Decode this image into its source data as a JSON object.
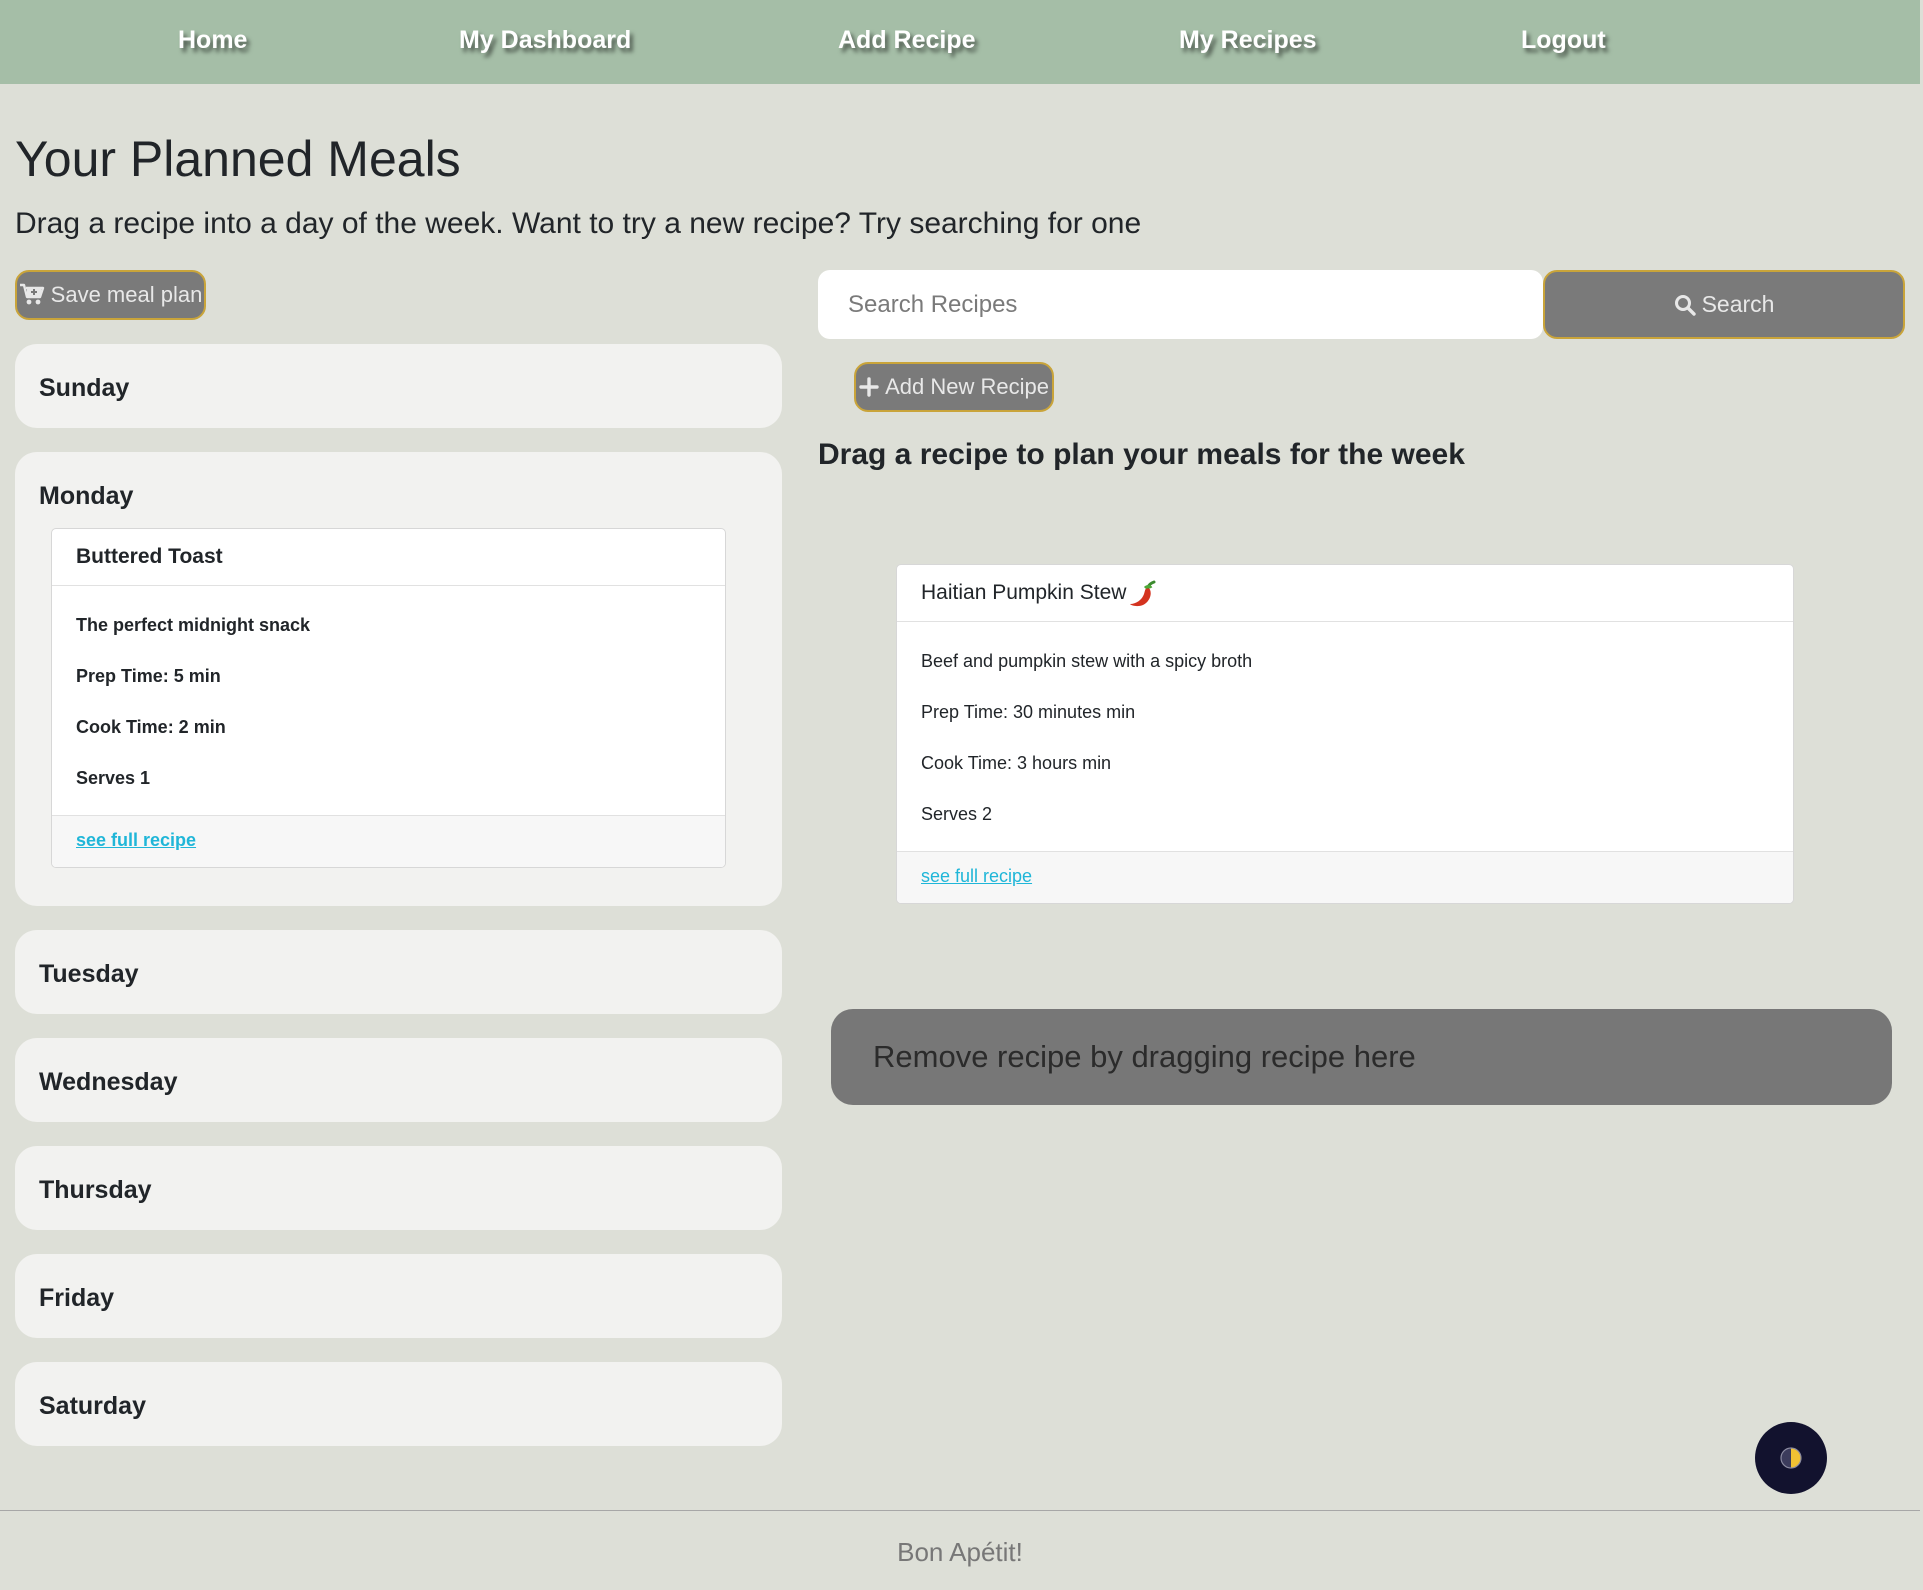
{
  "nav": {
    "items": [
      {
        "label": "Home"
      },
      {
        "label": "My Dashboard"
      },
      {
        "label": "Add Recipe"
      },
      {
        "label": "My Recipes"
      },
      {
        "label": "Logout"
      }
    ]
  },
  "header": {
    "title": "Your Planned Meals",
    "subtitle": "Drag a recipe into a day of the week. Want to try a new recipe? Try searching for one"
  },
  "planner": {
    "save_label": "Save meal plan",
    "days": [
      "Sunday",
      "Monday",
      "Tuesday",
      "Wednesday",
      "Thursday",
      "Friday",
      "Saturday"
    ],
    "monday_recipe": {
      "title": "Buttered Toast",
      "description": "The perfect midnight snack",
      "prep": "Prep Time: 5 min",
      "cook": "Cook Time: 2 min",
      "serves": "Serves 1",
      "link": "see full recipe"
    }
  },
  "search": {
    "placeholder": "Search Recipes",
    "button_label": "Search",
    "add_new_label": "Add New Recipe"
  },
  "available": {
    "heading": "Drag a recipe to plan your meals for the week",
    "recipe": {
      "title": "Haitian Pumpkin Stew",
      "description": "Beef and pumpkin stew with a spicy broth",
      "prep": "Prep Time: 30 minutes min",
      "cook": "Cook Time: 3 hours min",
      "serves": "Serves 2",
      "link": "see full recipe"
    }
  },
  "remove_zone": {
    "label": "Remove recipe by dragging recipe here"
  },
  "footer": {
    "text": "Bon Apétit!"
  },
  "icons": {
    "cart": "cart-icon",
    "search": "search-icon",
    "plus": "plus-icon",
    "pepper": "chili-pepper-icon",
    "theme": "theme-toggle-icon"
  },
  "colors": {
    "navbar": "#a5bea7",
    "background": "#dddfd7",
    "button": "#7a7a7a",
    "button_border": "#c9a43a",
    "link": "#1fb6d8",
    "theme_button": "#12122e"
  }
}
